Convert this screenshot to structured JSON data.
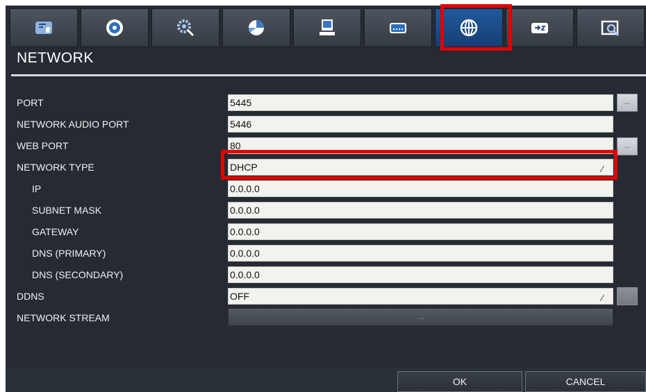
{
  "tabs": [
    {
      "icon": "camera-setup-icon",
      "active": false
    },
    {
      "icon": "record-icon",
      "active": false
    },
    {
      "icon": "settings-gear-icon",
      "active": false
    },
    {
      "icon": "schedule-pie-icon",
      "active": false
    },
    {
      "icon": "device-monitor-icon",
      "active": false
    },
    {
      "icon": "keyboard-icon",
      "active": false
    },
    {
      "icon": "network-globe-icon",
      "active": true
    },
    {
      "icon": "display-number-icon",
      "active": false
    },
    {
      "icon": "search-camera-icon",
      "active": false
    }
  ],
  "page_title": "NETWORK",
  "fields": {
    "port": {
      "label": "PORT",
      "value": "5445"
    },
    "audio_port": {
      "label": "NETWORK AUDIO PORT",
      "value": "5446"
    },
    "web_port": {
      "label": "WEB PORT",
      "value": "80"
    },
    "network_type": {
      "label": "NETWORK TYPE",
      "value": "DHCP"
    },
    "ip": {
      "label": "IP",
      "value": "0.0.0.0"
    },
    "subnet": {
      "label": "SUBNET MASK",
      "value": "0.0.0.0"
    },
    "gateway": {
      "label": "GATEWAY",
      "value": "0.0.0.0"
    },
    "dns1": {
      "label": "DNS (PRIMARY)",
      "value": "0.0.0.0"
    },
    "dns2": {
      "label": "DNS (SECONDARY)",
      "value": "0.0.0.0"
    },
    "ddns": {
      "label": "DDNS",
      "value": "OFF"
    },
    "stream": {
      "label": "NETWORK STREAM",
      "value": "..."
    }
  },
  "more_label": "...",
  "buttons": {
    "ok": "OK",
    "cancel": "CANCEL"
  },
  "colors": {
    "highlight": "#e00000",
    "active_tab": "#1a4a86"
  }
}
